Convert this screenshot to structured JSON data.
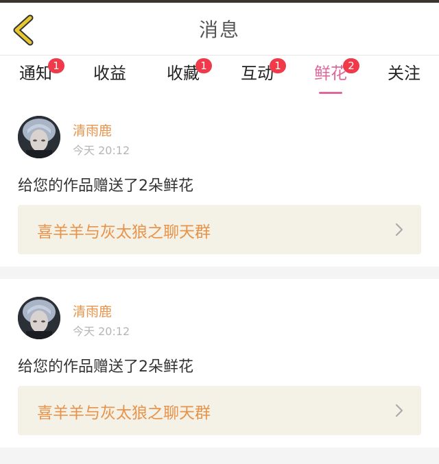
{
  "header": {
    "title": "消息"
  },
  "tabs": [
    {
      "label": "通知",
      "badge": "1"
    },
    {
      "label": "收益",
      "badge": ""
    },
    {
      "label": "收藏",
      "badge": "1"
    },
    {
      "label": "互动",
      "badge": "1"
    },
    {
      "label": "鲜花",
      "badge": "2",
      "active": true
    },
    {
      "label": "关注",
      "badge": ""
    }
  ],
  "messages": [
    {
      "user": "清雨鹿",
      "time": "今天 20:12",
      "text": "给您的作品赠送了2朵鲜花",
      "work_title": "喜羊羊与灰太狼之聊天群"
    },
    {
      "user": "清雨鹿",
      "time": "今天 20:12",
      "text": "给您的作品赠送了2朵鲜花",
      "work_title": "喜羊羊与灰太狼之聊天群"
    }
  ],
  "colors": {
    "accent": "#e0679a",
    "badge": "#f03a4a",
    "username": "#e8934a",
    "back_icon": "#e8c832"
  },
  "icons": {
    "back": "chevron-left-icon",
    "work_link": "chevron-right-icon",
    "avatar": "user-photo"
  }
}
